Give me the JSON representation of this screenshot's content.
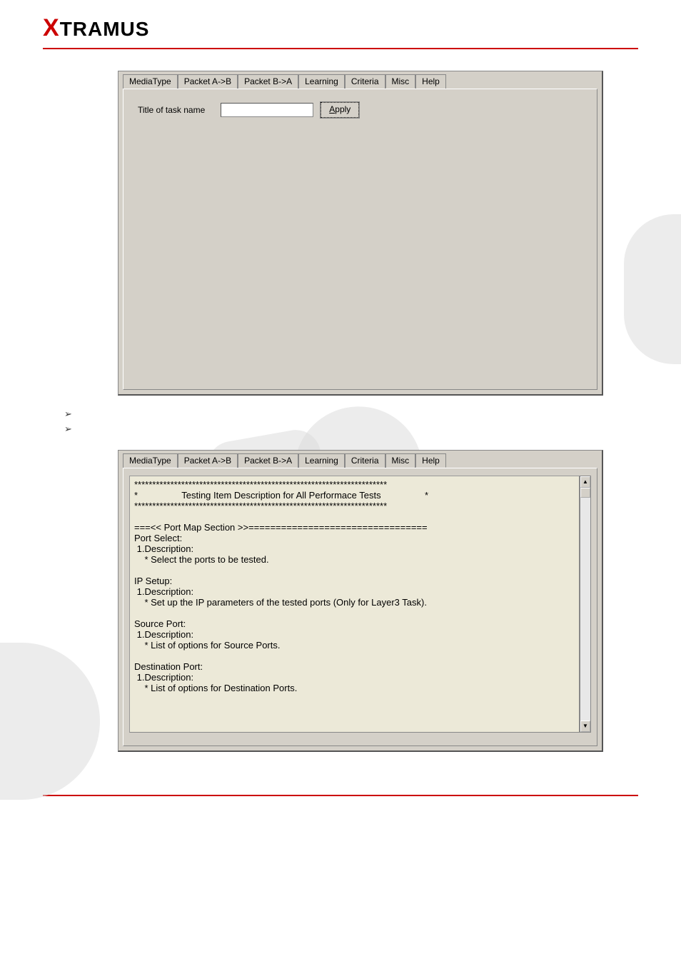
{
  "brand": {
    "x": "X",
    "rest": "TRAMUS"
  },
  "tabs1": [
    "MediaType",
    "Packet A->B",
    "Packet B->A",
    "Learning",
    "Criteria",
    "Misc",
    "Help"
  ],
  "tabs1_active": "Misc",
  "misc": {
    "label": "Title of task name",
    "value": "",
    "apply": "Apply"
  },
  "bullet_texts": [
    "",
    ""
  ],
  "tabs2": [
    "MediaType",
    "Packet A->B",
    "Packet B->A",
    "Learning",
    "Criteria",
    "Misc",
    "Help"
  ],
  "tabs2_active": "Help",
  "help_text": "**********************************************************************\n*                 Testing Item Description for All Performace Tests                 *\n**********************************************************************\n\n===<< Port Map Section >>=================================\nPort Select:\n 1.Description:\n    * Select the ports to be tested.\n\nIP Setup:\n 1.Description:\n    * Set up the IP parameters of the tested ports (Only for Layer3 Task).\n\nSource Port:\n 1.Description:\n    * List of options for Source Ports.\n\nDestination Port:\n 1.Description:\n    * List of options for Destination Ports."
}
